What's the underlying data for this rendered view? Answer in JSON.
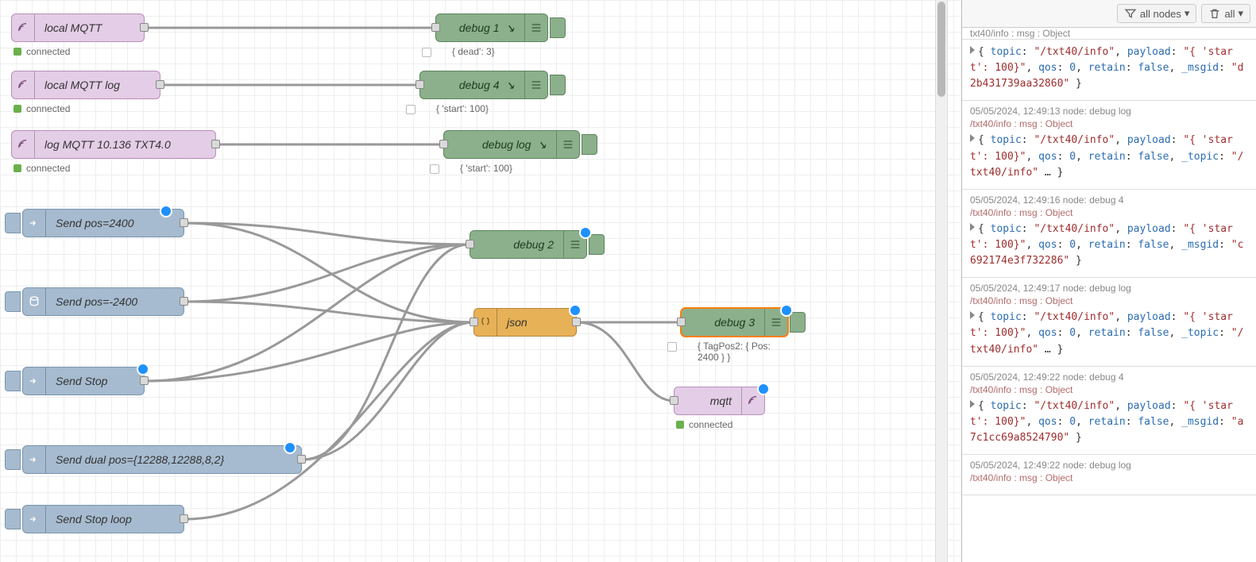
{
  "toolbar": {
    "filter_label": "all nodes",
    "clear_label": "all"
  },
  "nodes": {
    "mqtt_in_1": {
      "label": "local MQTT",
      "status": "connected"
    },
    "mqtt_in_2": {
      "label": "local MQTT log",
      "status": "connected"
    },
    "mqtt_in_3": {
      "label": "log MQTT 10.136 TXT4.0",
      "status": "connected"
    },
    "debug1": {
      "label": "debug 1",
      "status": "{ dead': 3}"
    },
    "debug4": {
      "label": "debug 4",
      "status": "{ 'start': 100}"
    },
    "debuglog": {
      "label": "debug log",
      "status": "{ 'start': 100}"
    },
    "debug2": {
      "label": "debug 2"
    },
    "debug3": {
      "label": "debug 3",
      "status": "{ TagPos2: { Pos: 2400 } }"
    },
    "json": {
      "label": "json"
    },
    "mqtt_out": {
      "label": "mqtt",
      "status": "connected"
    },
    "inj1": {
      "label": "Send pos=2400"
    },
    "inj2": {
      "label": "Send pos=-2400"
    },
    "inj3": {
      "label": "Send Stop"
    },
    "inj4": {
      "label": "Send dual pos={12288,12288,8,2}"
    },
    "inj5": {
      "label": "Send Stop loop"
    }
  },
  "cut_message": "txt40/info : msg : Object",
  "messages": [
    {
      "meta": "",
      "source": "",
      "body_html": "<span class='caret'></span>{ <span class='tok-key'>topic</span>: <span class='tok-str'>\"/txt40/info\"</span>, <span class='tok-key'>payload</span>: <span class='tok-str'>\"{ 'start': 100}\"</span>, <span class='tok-key'>qos</span>: <span class='tok-num'>0</span>, <span class='tok-key'>retain</span>: <span class='tok-bool'>false</span>, <span class='tok-key'>_msgid</span>: <span class='tok-str'>\"d2b431739aa32860\"</span> }"
    },
    {
      "meta": "05/05/2024, 12:49:13  node: debug log",
      "source": "/txt40/info : msg : Object",
      "body_html": "<span class='caret'></span>{ <span class='tok-key'>topic</span>: <span class='tok-str'>\"/txt40/info\"</span>, <span class='tok-key'>payload</span>: <span class='tok-str'>\"{ 'start': 100}\"</span>, <span class='tok-key'>qos</span>: <span class='tok-num'>0</span>, <span class='tok-key'>retain</span>: <span class='tok-bool'>false</span>, <span class='tok-key'>_topic</span>: <span class='tok-str'>\"/txt40/info\"</span> … }"
    },
    {
      "meta": "05/05/2024, 12:49:16  node: debug 4",
      "source": "/txt40/info : msg : Object",
      "body_html": "<span class='caret'></span>{ <span class='tok-key'>topic</span>: <span class='tok-str'>\"/txt40/info\"</span>, <span class='tok-key'>payload</span>: <span class='tok-str'>\"{ 'start': 100}\"</span>, <span class='tok-key'>qos</span>: <span class='tok-num'>0</span>, <span class='tok-key'>retain</span>: <span class='tok-bool'>false</span>, <span class='tok-key'>_msgid</span>: <span class='tok-str'>\"c692174e3f732286\"</span> }"
    },
    {
      "meta": "05/05/2024, 12:49:17  node: debug log",
      "source": "/txt40/info : msg : Object",
      "body_html": "<span class='caret'></span>{ <span class='tok-key'>topic</span>: <span class='tok-str'>\"/txt40/info\"</span>, <span class='tok-key'>payload</span>: <span class='tok-str'>\"{ 'start': 100}\"</span>, <span class='tok-key'>qos</span>: <span class='tok-num'>0</span>, <span class='tok-key'>retain</span>: <span class='tok-bool'>false</span>, <span class='tok-key'>_topic</span>: <span class='tok-str'>\"/txt40/info\"</span> … }"
    },
    {
      "meta": "05/05/2024, 12:49:22  node: debug 4",
      "source": "/txt40/info : msg : Object",
      "body_html": "<span class='caret'></span>{ <span class='tok-key'>topic</span>: <span class='tok-str'>\"/txt40/info\"</span>, <span class='tok-key'>payload</span>: <span class='tok-str'>\"{ 'start': 100}\"</span>, <span class='tok-key'>qos</span>: <span class='tok-num'>0</span>, <span class='tok-key'>retain</span>: <span class='tok-bool'>false</span>, <span class='tok-key'>_msgid</span>: <span class='tok-str'>\"a7c1cc69a8524790\"</span> }"
    },
    {
      "meta": "05/05/2024, 12:49:22  node: debug log",
      "source": "/txt40/info : msg : Object",
      "body_html": ""
    }
  ]
}
